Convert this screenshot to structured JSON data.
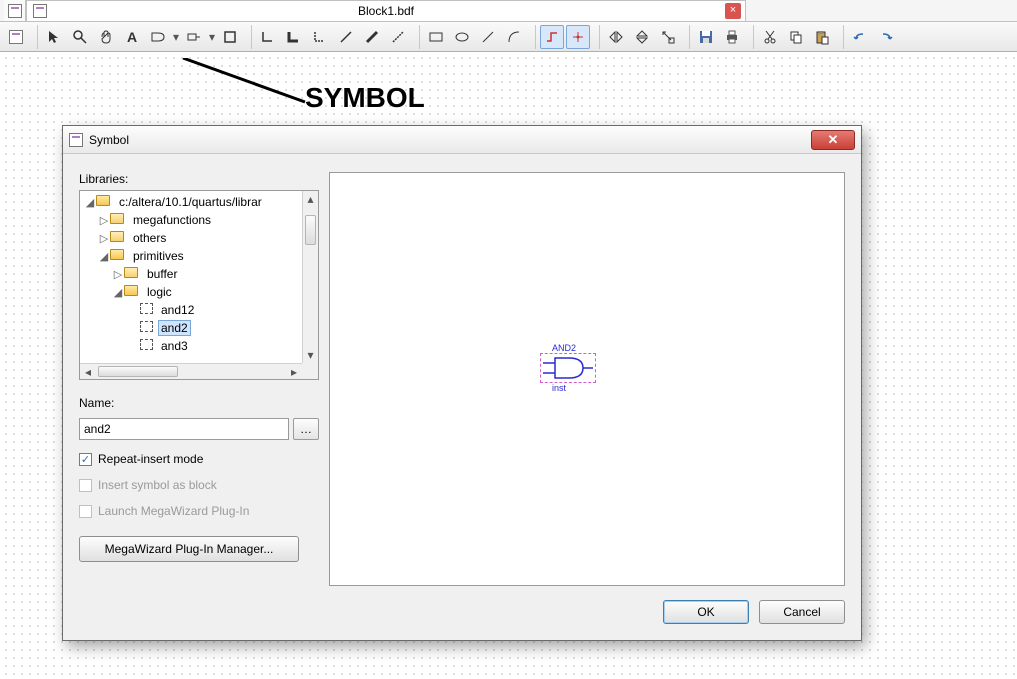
{
  "window": {
    "tab_title": "Block1.bdf"
  },
  "annotation": {
    "label": "SYMBOL"
  },
  "dialog": {
    "title": "Symbol",
    "libraries_label": "Libraries:",
    "tree": {
      "root": "c:/altera/10.1/quartus/librar",
      "items": [
        {
          "level": 1,
          "expander": "▴",
          "kind": "folder-open",
          "label": "c:/altera/10.1/quartus/librar"
        },
        {
          "level": 2,
          "expander": "▹",
          "kind": "folder-closed",
          "label": "megafunctions"
        },
        {
          "level": 2,
          "expander": "▹",
          "kind": "folder-closed",
          "label": "others"
        },
        {
          "level": 2,
          "expander": "▴",
          "kind": "folder-open",
          "label": "primitives"
        },
        {
          "level": 3,
          "expander": "▹",
          "kind": "folder-closed",
          "label": "buffer"
        },
        {
          "level": 3,
          "expander": "▴",
          "kind": "folder-open",
          "label": "logic"
        },
        {
          "level": 4,
          "expander": "",
          "kind": "symbol",
          "label": "and12"
        },
        {
          "level": 4,
          "expander": "",
          "kind": "symbol",
          "label": "and2",
          "selected": true
        },
        {
          "level": 4,
          "expander": "",
          "kind": "symbol",
          "label": "and3"
        }
      ]
    },
    "name_label": "Name:",
    "name_value": "and2",
    "repeat_label": "Repeat-insert mode",
    "repeat_checked": true,
    "insert_block_label": "Insert symbol as block",
    "launch_mw_label": "Launch MegaWizard Plug-In",
    "mega_button": "MegaWizard Plug-In Manager...",
    "preview": {
      "gate_label": "AND2",
      "instance_label": "inst"
    },
    "ok_label": "OK",
    "cancel_label": "Cancel"
  }
}
